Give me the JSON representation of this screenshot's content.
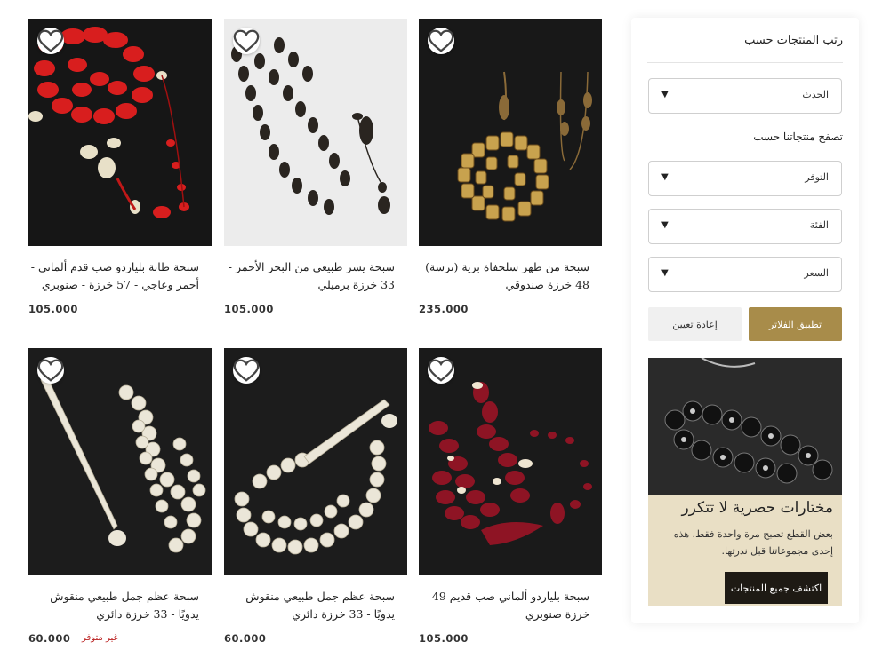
{
  "sidebar": {
    "sort_title": "رتب المنتجات حسب",
    "sort_value": "الحدث",
    "browse_title": "تصفح منتجاتنا حسب",
    "filters": [
      {
        "label": "التوفر"
      },
      {
        "label": "الفئة"
      },
      {
        "label": "السعر"
      }
    ],
    "apply_label": "تطبيق الفلاتر",
    "reset_label": "إعادة تعيين",
    "promo": {
      "heading": "مختارات حصرية لا تتكرر",
      "text": "بعض القطع تصبح مرة واحدة فقط، هذه إحدى مجموعاتنا قبل ندرتها.",
      "button": "اكتشف جميع المنتجات"
    }
  },
  "products": [
    {
      "title": "سبحة من ظهر سلحفاة برية (ترسة) 48 خرزة صندوقي",
      "price": "235.000",
      "status": ""
    },
    {
      "title": "سبحة يسر طبيعي من البحر الأحمر - 33 خرزة برميلي",
      "price": "105.000",
      "status": ""
    },
    {
      "title": "سبحة طابة بلياردو صب قدم ألماني - أحمر وعاجي - 57 خرزة - صنوبري",
      "price": "105.000",
      "status": ""
    },
    {
      "title": "سبحة بلياردو ألماني صب قديم 49 خرزة صنوبري",
      "price": "105.000",
      "status": ""
    },
    {
      "title": "سبحة عظم جمل طبيعي منقوش يدويًا - 33 خرزة دائري",
      "price": "60.000",
      "status": ""
    },
    {
      "title": "سبحة عظم جمل طبيعي منقوش يدويًا - 33 خرزة دائري",
      "price": "60.000",
      "status": "غير متوفر"
    }
  ],
  "colors": {
    "accent": "#a88c4a",
    "promo_bg": "#e9dfc5",
    "promo_button": "#1e1a14",
    "out_of_stock": "#bb2222"
  }
}
